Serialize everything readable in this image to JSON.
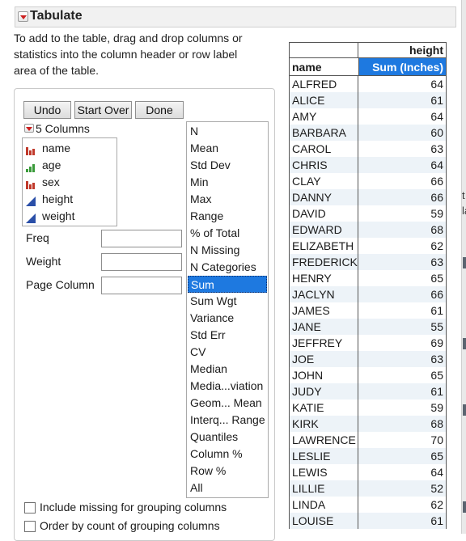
{
  "window": {
    "title": "Tabulate"
  },
  "instructions": "To add to the table, drag and drop columns or statistics into the column header or row label area of the table.",
  "toolbar": {
    "undo": "Undo",
    "start_over": "Start Over",
    "done": "Done"
  },
  "columns": {
    "header": "5 Columns",
    "items": [
      {
        "label": "name",
        "icon": "nominal-icon",
        "color": "#c0392b"
      },
      {
        "label": "age",
        "icon": "ordinal-icon",
        "color": "#3a9a3a"
      },
      {
        "label": "sex",
        "icon": "nominal-icon",
        "color": "#c0392b"
      },
      {
        "label": "height",
        "icon": "continuous-icon",
        "color": "#2a4fa8"
      },
      {
        "label": "weight",
        "icon": "continuous-icon",
        "color": "#2a4fa8"
      }
    ]
  },
  "fields": {
    "freq": "Freq",
    "weight": "Weight",
    "page_column": "Page Column"
  },
  "statistics": {
    "items": [
      "N",
      "Mean",
      "Std Dev",
      "Min",
      "Max",
      "Range",
      "% of Total",
      "N Missing",
      "N Categories",
      "Sum",
      "Sum Wgt",
      "Variance",
      "Std Err",
      "CV",
      "Median",
      "Media...viation",
      "Geom... Mean",
      "Interq... Range",
      "Quantiles",
      "Column %",
      "Row %",
      "All"
    ],
    "selected": "Sum"
  },
  "options": {
    "include_missing": "Include missing for grouping columns",
    "order_by_count": "Order by count of grouping columns"
  },
  "table": {
    "col_group": "height",
    "row_header": "name",
    "col_header": "Sum (Inches)",
    "rows": [
      {
        "name": "ALFRED",
        "value": "64"
      },
      {
        "name": "ALICE",
        "value": "61"
      },
      {
        "name": "AMY",
        "value": "64"
      },
      {
        "name": "BARBARA",
        "value": "60"
      },
      {
        "name": "CAROL",
        "value": "63"
      },
      {
        "name": "CHRIS",
        "value": "64"
      },
      {
        "name": "CLAY",
        "value": "66"
      },
      {
        "name": "DANNY",
        "value": "66"
      },
      {
        "name": "DAVID",
        "value": "59"
      },
      {
        "name": "EDWARD",
        "value": "68"
      },
      {
        "name": "ELIZABETH",
        "value": "62"
      },
      {
        "name": "FREDERICK",
        "value": "63"
      },
      {
        "name": "HENRY",
        "value": "65"
      },
      {
        "name": "JACLYN",
        "value": "66"
      },
      {
        "name": "JAMES",
        "value": "61"
      },
      {
        "name": "JANE",
        "value": "55"
      },
      {
        "name": "JEFFREY",
        "value": "69"
      },
      {
        "name": "JOE",
        "value": "63"
      },
      {
        "name": "JOHN",
        "value": "65"
      },
      {
        "name": "JUDY",
        "value": "61"
      },
      {
        "name": "KATIE",
        "value": "59"
      },
      {
        "name": "KIRK",
        "value": "68"
      },
      {
        "name": "LAWRENCE",
        "value": "70"
      },
      {
        "name": "LESLIE",
        "value": "65"
      },
      {
        "name": "LEWIS",
        "value": "64"
      },
      {
        "name": "LILLIE",
        "value": "52"
      },
      {
        "name": "LINDA",
        "value": "62"
      },
      {
        "name": "LOUISE",
        "value": "61"
      }
    ]
  },
  "edge_fragments": [
    "t",
    "la"
  ]
}
